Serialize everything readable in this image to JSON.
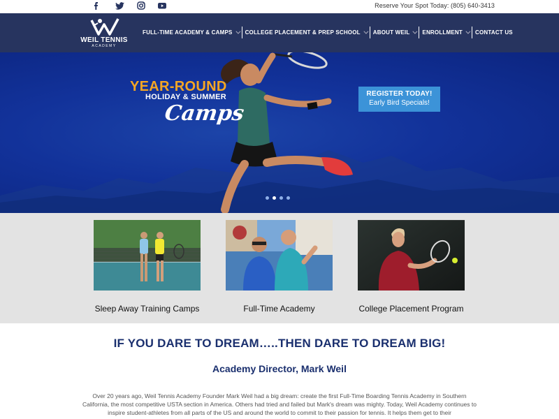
{
  "topbar": {
    "social_icons": [
      "facebook-icon",
      "twitter-icon",
      "instagram-icon",
      "youtube-icon"
    ],
    "reserve_text": "Reserve Your Spot Today: (805) 640-3413"
  },
  "logo": {
    "name": "WEIL TENNIS",
    "sub": "ACADEMY"
  },
  "nav": {
    "items": [
      {
        "label": "FULL-TIME ACADEMY & CAMPS",
        "dropdown": true
      },
      {
        "label": "COLLEGE PLACEMENT & PREP SCHOOL",
        "dropdown": true
      },
      {
        "label": "ABOUT WEIL",
        "dropdown": true
      },
      {
        "label": "ENROLLMENT",
        "dropdown": true
      },
      {
        "label": "CONTACT US",
        "dropdown": false
      }
    ]
  },
  "hero": {
    "title_1": "YEAR-ROUND",
    "title_2": "HOLIDAY & SUMMER",
    "title_3": "Camps",
    "cta_line_1": "REGISTER TODAY!",
    "cta_line_2": "Early Bird Specials!",
    "slide_count": 4,
    "active_slide": 1
  },
  "programs": [
    {
      "caption": "Sleep Away Training Camps"
    },
    {
      "caption": "Full-Time Academy"
    },
    {
      "caption": "College Placement Program"
    }
  ],
  "content": {
    "headline": "IF YOU DARE TO DREAM…..THEN DARE TO DREAM BIG!",
    "subhead": "Academy Director, Mark Weil",
    "body": "Over 20 years ago, Weil Tennis Academy Founder Mark Weil had a big dream: create the first Full-Time Boarding Tennis Academy in Southern California, the most competitive USTA section in America. Others had tried and failed but Mark's dream was mighty. Today, Weil Academy continues to inspire student-athletes from all parts of the US and around the world to commit to their passion for tennis. It helps them get to their"
  },
  "colors": {
    "nav_bg": "#27345f",
    "hero_blue": "#12329a",
    "accent_orange": "#f5a623",
    "cta_blue": "#3c93d8",
    "heading_navy": "#1a2f6e",
    "programs_bg": "#e3e3e3"
  }
}
